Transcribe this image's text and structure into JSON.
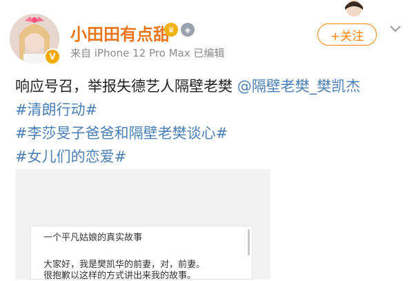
{
  "post": {
    "username": "小田田有点甜",
    "source": "来自 iPhone 12 Pro Max  已编辑",
    "follow_label": "+关注",
    "text_prefix": "响应号召，举报失德艺人隔壁老樊 ",
    "mention": "@隔壁老樊_樊凯杰",
    "topics": [
      "#清朗行动#",
      "#李莎旻子爸爸和隔壁老樊谈心#",
      "#女儿们的恋爱#"
    ]
  },
  "attachment": {
    "title": "一个平凡姑娘的真实故事",
    "line1": "大家好，我是樊凯华的前妻，对，前妻。",
    "line2": "很抱歉以这样的方式讲出来我的故事。"
  },
  "colors": {
    "username": "#e8751a",
    "topic": "#4a7fb6",
    "follow": "#ff8200",
    "verified": "#f2a900"
  },
  "icons": {
    "avatar": "user-avatar",
    "verified": "verified-icon",
    "crown_badge": "crown-badge-icon",
    "rank_badge": "rank-badge-icon",
    "chevron": "chevron-down-icon"
  }
}
